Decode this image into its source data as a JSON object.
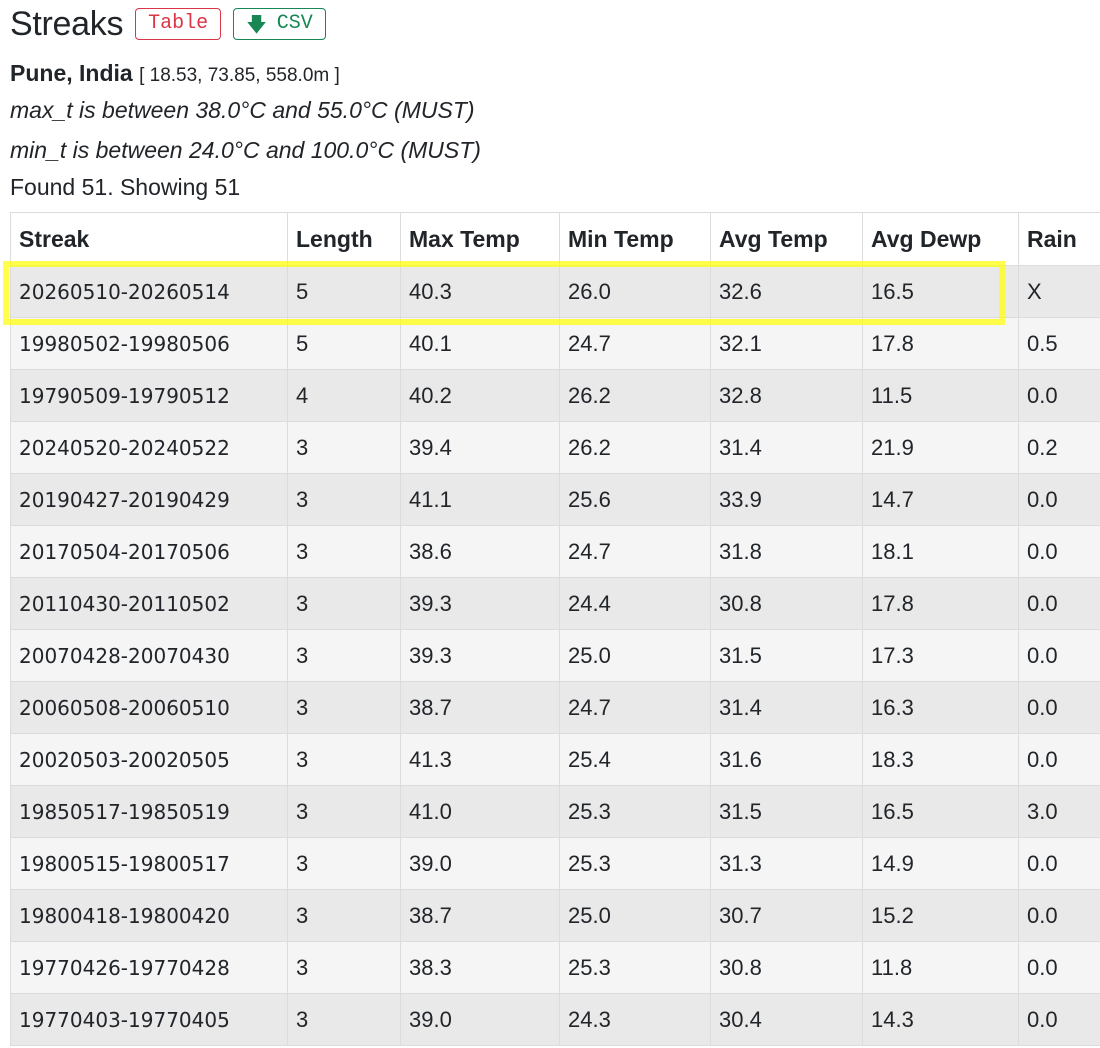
{
  "header": {
    "title": "Streaks",
    "table_button": "Table",
    "csv_button": "CSV",
    "csv_icon": "download-arrow-icon"
  },
  "location": {
    "name": "Pune, India",
    "coords": "[ 18.53, 73.85, 558.0m ]"
  },
  "criteria": [
    "max_t is between 38.0°C and 55.0°C (MUST)",
    "min_t is between 24.0°C and 100.0°C (MUST)"
  ],
  "found_text": "Found 51. Showing 51",
  "table": {
    "columns": [
      "Streak",
      "Length",
      "Max Temp",
      "Min Temp",
      "Avg Temp",
      "Avg Dewp",
      "Rain"
    ],
    "rows": [
      [
        "20260510-20260514",
        "5",
        "40.3",
        "26.0",
        "32.6",
        "16.5",
        "X"
      ],
      [
        "19980502-19980506",
        "5",
        "40.1",
        "24.7",
        "32.1",
        "17.8",
        "0.5"
      ],
      [
        "19790509-19790512",
        "4",
        "40.2",
        "26.2",
        "32.8",
        "11.5",
        "0.0"
      ],
      [
        "20240520-20240522",
        "3",
        "39.4",
        "26.2",
        "31.4",
        "21.9",
        "0.2"
      ],
      [
        "20190427-20190429",
        "3",
        "41.1",
        "25.6",
        "33.9",
        "14.7",
        "0.0"
      ],
      [
        "20170504-20170506",
        "3",
        "38.6",
        "24.7",
        "31.8",
        "18.1",
        "0.0"
      ],
      [
        "20110430-20110502",
        "3",
        "39.3",
        "24.4",
        "30.8",
        "17.8",
        "0.0"
      ],
      [
        "20070428-20070430",
        "3",
        "39.3",
        "25.0",
        "31.5",
        "17.3",
        "0.0"
      ],
      [
        "20060508-20060510",
        "3",
        "38.7",
        "24.7",
        "31.4",
        "16.3",
        "0.0"
      ],
      [
        "20020503-20020505",
        "3",
        "41.3",
        "25.4",
        "31.6",
        "18.3",
        "0.0"
      ],
      [
        "19850517-19850519",
        "3",
        "41.0",
        "25.3",
        "31.5",
        "16.5",
        "3.0"
      ],
      [
        "19800515-19800517",
        "3",
        "39.0",
        "25.3",
        "31.3",
        "14.9",
        "0.0"
      ],
      [
        "19800418-19800420",
        "3",
        "38.7",
        "25.0",
        "30.7",
        "15.2",
        "0.0"
      ],
      [
        "19770426-19770428",
        "3",
        "38.3",
        "25.3",
        "30.8",
        "11.8",
        "0.0"
      ],
      [
        "19770403-19770405",
        "3",
        "39.0",
        "24.3",
        "30.4",
        "14.3",
        "0.0"
      ]
    ]
  },
  "colors": {
    "table_button": "#dc3545",
    "csv_button": "#198754",
    "highlight": "#ffff00"
  }
}
